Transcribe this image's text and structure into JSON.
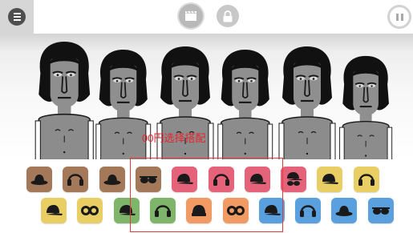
{
  "selection": {
    "label": "00円选择搭配"
  },
  "colors": {
    "brown": "#a3795a",
    "yellow": "#e9cf63",
    "green": "#7fb56a",
    "orange": "#f29a63",
    "red": "#e4627a",
    "blue": "#5aa0df"
  },
  "icons": {
    "menu": "menu-icon",
    "record": "clapperboard-icon",
    "lock": "lock-icon",
    "pause": "pause-icon"
  },
  "characters": [
    {
      "name": "character-1"
    },
    {
      "name": "character-2"
    },
    {
      "name": "character-3"
    },
    {
      "name": "character-4"
    },
    {
      "name": "character-5"
    },
    {
      "name": "character-6"
    }
  ],
  "palette": {
    "row1": [
      {
        "icon": "fedora-hat-icon",
        "color": "brown"
      },
      {
        "icon": "headphones-icon",
        "color": "brown"
      },
      {
        "icon": "fedora-hat-icon",
        "color": "brown"
      },
      {
        "icon": "sunglasses-icon",
        "color": "brown"
      },
      {
        "icon": "cap-icon",
        "color": "red"
      },
      {
        "icon": "headphones-icon",
        "color": "red"
      },
      {
        "icon": "cap-icon",
        "color": "red"
      },
      {
        "icon": "glasses-cap-icon",
        "color": "red"
      },
      {
        "icon": "cap-icon",
        "color": "yellow"
      },
      {
        "icon": "headphones-icon",
        "color": "yellow"
      }
    ],
    "row2": [
      {
        "icon": "cap-icon",
        "color": "yellow"
      },
      {
        "icon": "goggles-icon",
        "color": "yellow"
      },
      {
        "icon": "cap-icon",
        "color": "green"
      },
      {
        "icon": "headphones-icon",
        "color": "green"
      },
      {
        "icon": "beanie-icon",
        "color": "orange"
      },
      {
        "icon": "goggles-icon",
        "color": "orange"
      },
      {
        "icon": "cap-icon",
        "color": "blue"
      },
      {
        "icon": "headphones-icon",
        "color": "blue"
      },
      {
        "icon": "fedora-hat-icon",
        "color": "blue"
      },
      {
        "icon": "sunglasses-icon",
        "color": "blue"
      }
    ]
  }
}
